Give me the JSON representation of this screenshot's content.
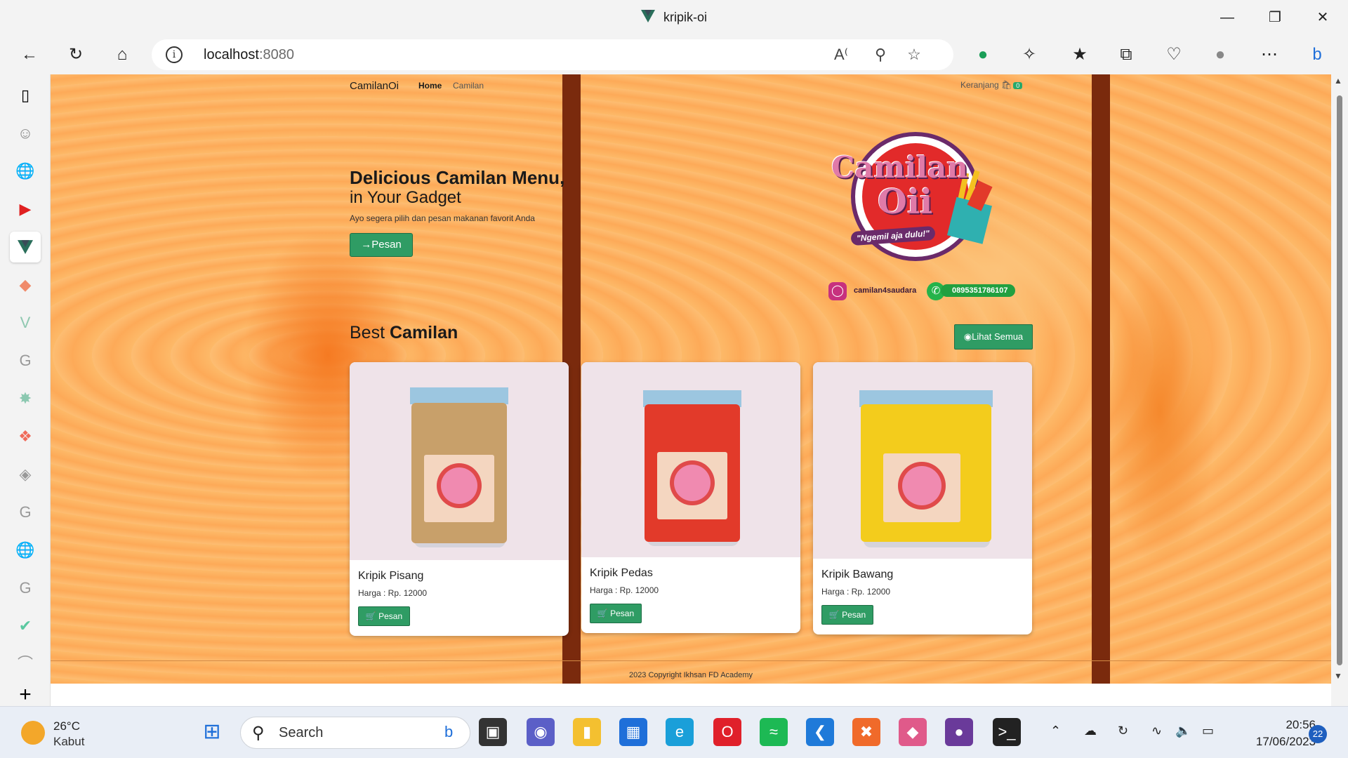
{
  "browser": {
    "tab_title": "kripik-oi",
    "url_host": "localhost",
    "url_port": ":8080"
  },
  "site": {
    "brand": "CamilanOi",
    "nav": {
      "home": "Home",
      "camilan": "Camilan"
    },
    "cart": {
      "label": "Keranjang",
      "count": "0"
    },
    "hero": {
      "title": "Delicious Camilan Menu,",
      "subtitle": "in Your Gadget",
      "description": "Ayo segera pilih dan pesan makanan favorit Anda",
      "button": "Pesan"
    },
    "logo": {
      "line1": "Camilan",
      "line2": "Oii",
      "tagline": "\"Ngemil aja dulu!\"",
      "instagram": "camilan4saudara",
      "whatsapp": "0895351786107"
    },
    "best": {
      "prefix": "Best",
      "bold": "Camilan",
      "view_all": "Lihat Semua"
    },
    "products": [
      {
        "name": "Kripik Pisang",
        "price": "Harga : Rp. 12000",
        "button": "Pesan",
        "fill": "#c8a06a"
      },
      {
        "name": "Kripik Pedas",
        "price": "Harga : Rp. 12000",
        "button": "Pesan",
        "fill": "#e23a2a"
      },
      {
        "name": "Kripik Bawang",
        "price": "Harga : Rp. 12000",
        "button": "Pesan",
        "fill": "#f3cc1c"
      }
    ],
    "footer": "2023 Copyright Ikhsan FD Academy"
  },
  "taskbar": {
    "weather": {
      "temp": "26°C",
      "condition": "Kabut"
    },
    "search": "Search",
    "time": "20:56",
    "date": "17/06/2023",
    "notifications": "22"
  },
  "colors": {
    "accent_green": "#2f9c64",
    "pillar": "#7a2a0d",
    "background_orange": "#fbb263"
  }
}
